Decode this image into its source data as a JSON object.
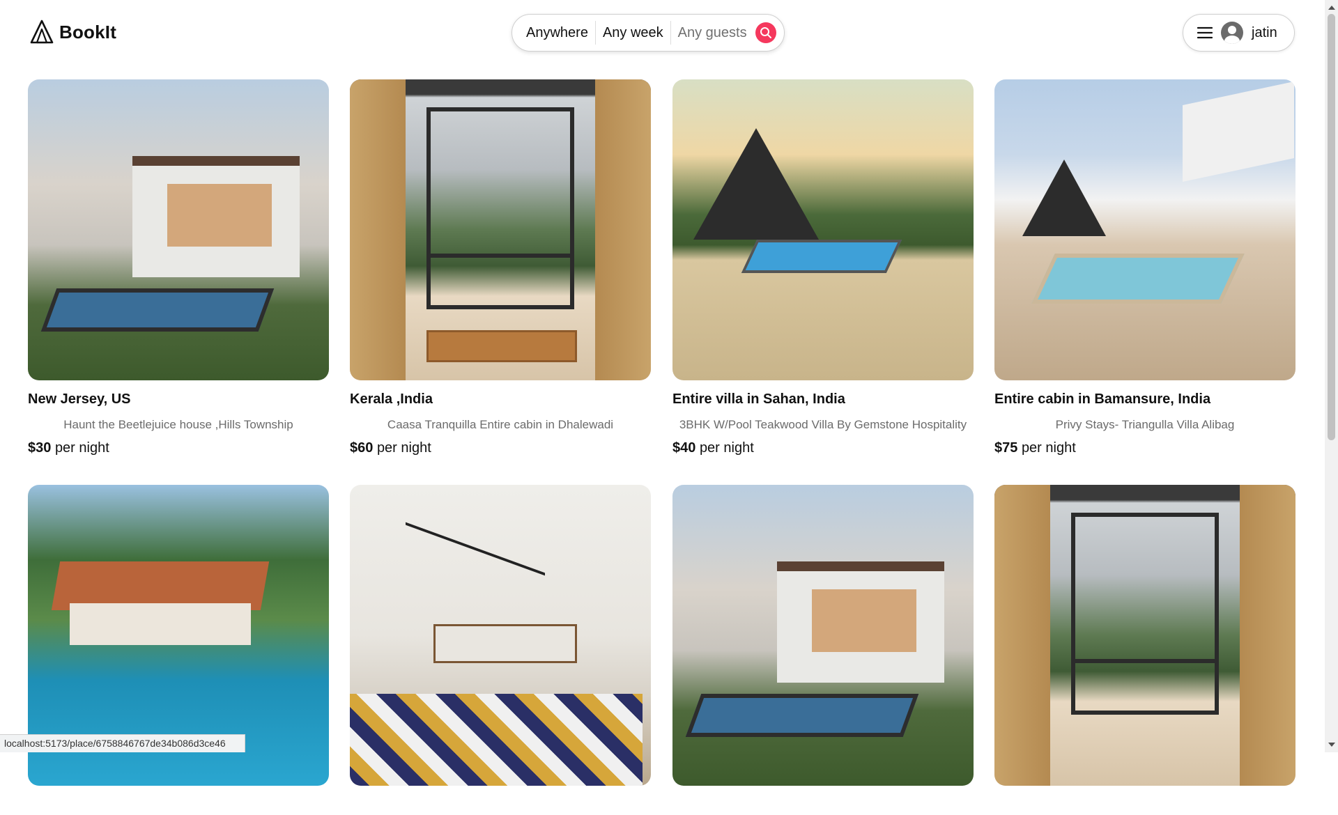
{
  "app": {
    "name": "BookIt",
    "logo_icon": "tent-icon"
  },
  "search": {
    "where": "Anywhere",
    "when": "Any week",
    "guests": "Any guests",
    "icon": "search-icon",
    "accent": "#f5385d"
  },
  "user": {
    "name": "jatin",
    "menu_icon": "hamburger-icon",
    "avatar_icon": "user-avatar-icon"
  },
  "listings": [
    {
      "title": "New Jersey, US",
      "subtitle": "Haunt the Beetlejuice house ,Hills Township",
      "price": "$30",
      "per": "per night"
    },
    {
      "title": "Kerala ,India",
      "subtitle": "Caasa Tranquilla Entire cabin in Dhalewadi",
      "price": "$60",
      "per": "per night"
    },
    {
      "title": "Entire villa in Sahan, India",
      "subtitle": "3BHK W/Pool Teakwood Villa By Gemstone Hospitality",
      "price": "$40",
      "per": "per night"
    },
    {
      "title": "Entire cabin in Bamansure, India",
      "subtitle": "Privy Stays- Triangulla Villa Alibag",
      "price": "$75",
      "per": "per night"
    },
    {
      "title": "",
      "subtitle": "",
      "price": "",
      "per": ""
    },
    {
      "title": "",
      "subtitle": "",
      "price": "",
      "per": ""
    },
    {
      "title": "",
      "subtitle": "",
      "price": "",
      "per": ""
    },
    {
      "title": "",
      "subtitle": "",
      "price": "",
      "per": ""
    }
  ],
  "status_url": "localhost:5173/place/6758846767de34b086d3ce46"
}
